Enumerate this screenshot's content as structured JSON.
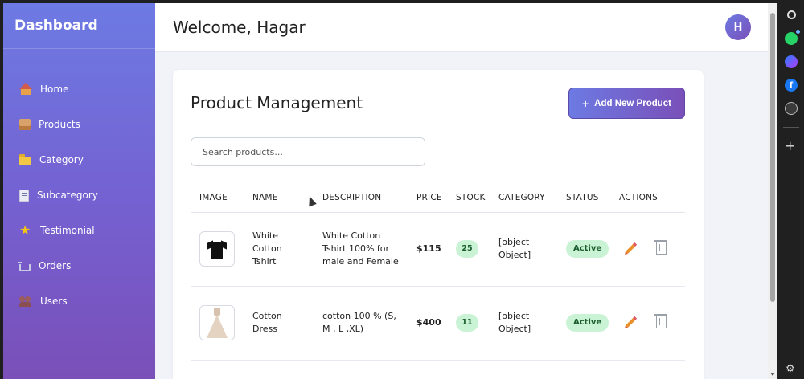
{
  "sidebar": {
    "brand": "Dashboard",
    "items": [
      {
        "label": "Home",
        "icon": "home-icon"
      },
      {
        "label": "Products",
        "icon": "box-icon"
      },
      {
        "label": "Category",
        "icon": "folder-icon"
      },
      {
        "label": "Subcategory",
        "icon": "document-icon"
      },
      {
        "label": "Testimonial",
        "icon": "star-icon"
      },
      {
        "label": "Orders",
        "icon": "cart-icon"
      },
      {
        "label": "Users",
        "icon": "users-icon"
      }
    ]
  },
  "header": {
    "welcome": "Welcome, Hagar",
    "avatar_initial": "H"
  },
  "products": {
    "title": "Product Management",
    "add_button": "Add New Product",
    "add_button_icon": "+",
    "search_placeholder": "Search products...",
    "columns": [
      "IMAGE",
      "NAME",
      "DESCRIPTION",
      "PRICE",
      "STOCK",
      "CATEGORY",
      "STATUS",
      "ACTIONS"
    ],
    "rows": [
      {
        "image": "tshirt-image",
        "name": "White Cotton Tshirt",
        "description": "White Cotton Tshirt 100% for male and Female",
        "price": "$115",
        "stock": "25",
        "category": "[object Object]",
        "status": "Active"
      },
      {
        "image": "dress-image",
        "name": "Cotton Dress",
        "description": "cotton 100 % (S, M , L ,XL)",
        "price": "$400",
        "stock": "11",
        "category": "[object Object]",
        "status": "Active"
      }
    ]
  },
  "colors": {
    "sidebar_gradient_start": "#6d7ae3",
    "sidebar_gradient_end": "#7a4fb8",
    "badge_bg": "#c9f3d4",
    "badge_text": "#1b5e2e"
  },
  "browser_panel": {
    "icons": [
      "search-icon",
      "whatsapp-icon",
      "messenger-icon",
      "facebook-icon",
      "ai-icon",
      "plus-icon",
      "gear-icon"
    ],
    "facebook_glyph": "f",
    "plus_glyph": "+",
    "gear_glyph": "⚙"
  }
}
